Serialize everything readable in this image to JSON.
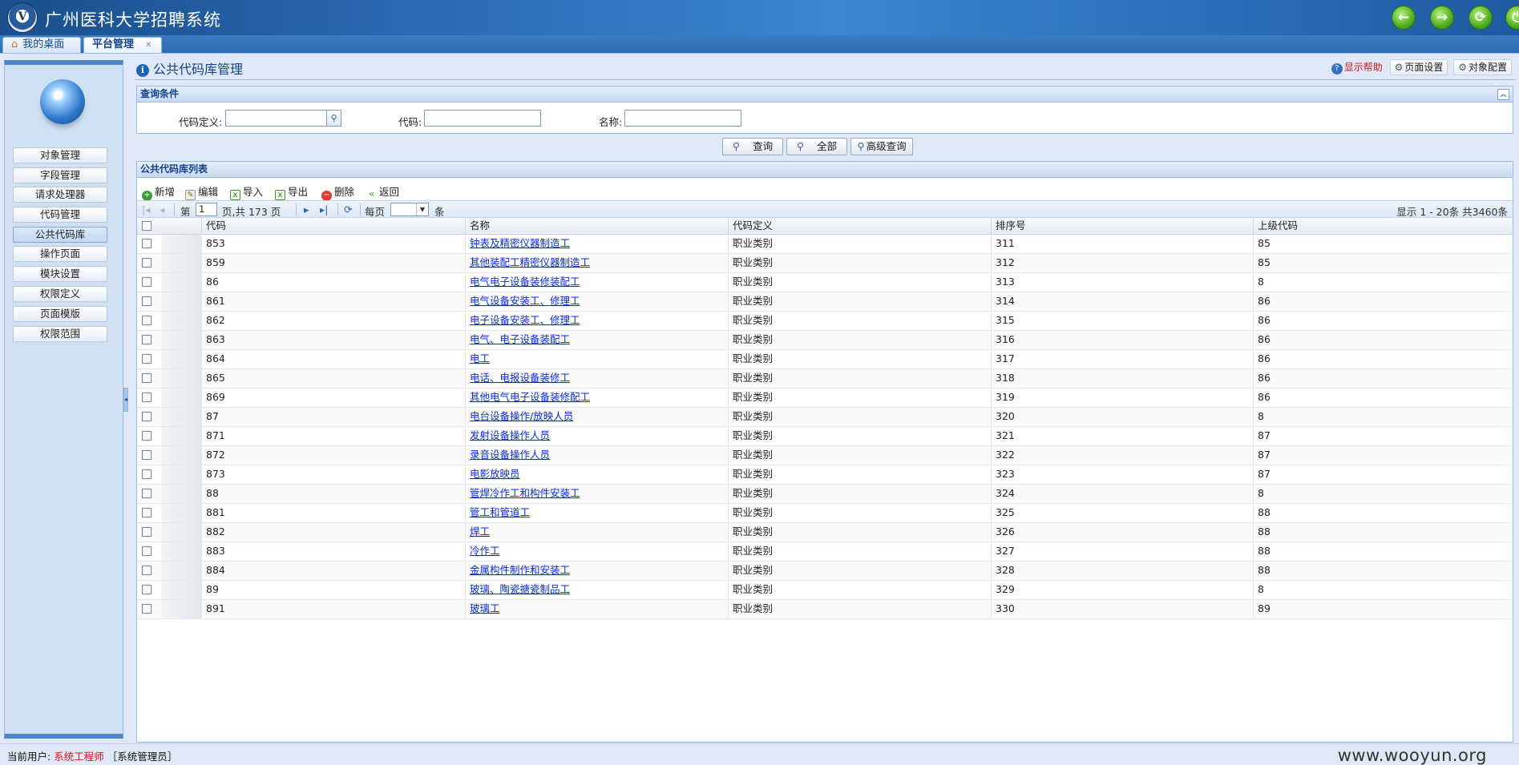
{
  "app": {
    "title": "广州医科大学招聘系统"
  },
  "colors": {
    "header": "#2b6db5",
    "link": "#0b2bd6",
    "help": "#d2161b",
    "panel_border": "#99bbe8"
  },
  "tabs": [
    {
      "label": "我的桌面",
      "icon": "home-icon"
    },
    {
      "label": "平台管理",
      "icon": "close-icon"
    }
  ],
  "sidebar": {
    "items": [
      {
        "label": "对象管理"
      },
      {
        "label": "字段管理"
      },
      {
        "label": "请求处理器"
      },
      {
        "label": "代码管理"
      },
      {
        "label": "公共代码库",
        "active": true
      },
      {
        "label": "操作页面"
      },
      {
        "label": "模块设置"
      },
      {
        "label": "权限定义"
      },
      {
        "label": "页面模版"
      },
      {
        "label": "权限范围"
      }
    ]
  },
  "page": {
    "title": "公共代码库管理",
    "help_label": "显示帮助",
    "page_settings_label": "页面设置",
    "object_config_label": "对象配置"
  },
  "query": {
    "title": "查询条件",
    "code_def_label": "代码定义:",
    "code_label": "代码:",
    "name_label": "名称:",
    "code_def_value": "",
    "code_value": "",
    "name_value": "",
    "search_button": "查询",
    "all_button": "全部",
    "advanced_button": "高级查询"
  },
  "list": {
    "title": "公共代码库列表",
    "toolbar": {
      "add": "新增",
      "edit": "编辑",
      "import": "导入",
      "export": "导出",
      "delete": "删除",
      "back": "返回"
    },
    "pager": {
      "page_prefix": "第",
      "page_value": "1",
      "page_suffix": "页,共 173 页",
      "per_page_label": "每页",
      "per_page_unit": "条",
      "summary": "显示 1 - 20条 共3460条"
    },
    "columns": [
      "代码",
      "名称",
      "代码定义",
      "排序号",
      "上级代码"
    ],
    "rows": [
      {
        "code": "853",
        "name": "钟表及精密仪器制造工",
        "def": "职业类别",
        "sort": "311",
        "parent": "85"
      },
      {
        "code": "859",
        "name": "其他装配工精密仪器制造工",
        "def": "职业类别",
        "sort": "312",
        "parent": "85"
      },
      {
        "code": "86",
        "name": "电气电子设备装修装配工",
        "def": "职业类别",
        "sort": "313",
        "parent": "8"
      },
      {
        "code": "861",
        "name": "电气设备安装工、修理工",
        "def": "职业类别",
        "sort": "314",
        "parent": "86"
      },
      {
        "code": "862",
        "name": "电子设备安装工、修理工",
        "def": "职业类别",
        "sort": "315",
        "parent": "86"
      },
      {
        "code": "863",
        "name": "电气、电子设备装配工",
        "def": "职业类别",
        "sort": "316",
        "parent": "86"
      },
      {
        "code": "864",
        "name": "电工",
        "def": "职业类别",
        "sort": "317",
        "parent": "86"
      },
      {
        "code": "865",
        "name": "电话、电报设备装修工",
        "def": "职业类别",
        "sort": "318",
        "parent": "86"
      },
      {
        "code": "869",
        "name": "其他电气电子设备装修配工",
        "def": "职业类别",
        "sort": "319",
        "parent": "86"
      },
      {
        "code": "87",
        "name": "电台设备操作/放映人员",
        "def": "职业类别",
        "sort": "320",
        "parent": "8"
      },
      {
        "code": "871",
        "name": "发射设备操作人员",
        "def": "职业类别",
        "sort": "321",
        "parent": "87"
      },
      {
        "code": "872",
        "name": "录音设备操作人员",
        "def": "职业类别",
        "sort": "322",
        "parent": "87"
      },
      {
        "code": "873",
        "name": "电影放映员",
        "def": "职业类别",
        "sort": "323",
        "parent": "87"
      },
      {
        "code": "88",
        "name": "管焊冷作工和构件安装工",
        "def": "职业类别",
        "sort": "324",
        "parent": "8"
      },
      {
        "code": "881",
        "name": "管工和管道工",
        "def": "职业类别",
        "sort": "325",
        "parent": "88"
      },
      {
        "code": "882",
        "name": "焊工",
        "def": "职业类别",
        "sort": "326",
        "parent": "88"
      },
      {
        "code": "883",
        "name": "冷作工",
        "def": "职业类别",
        "sort": "327",
        "parent": "88"
      },
      {
        "code": "884",
        "name": "金属构件制作和安装工",
        "def": "职业类别",
        "sort": "328",
        "parent": "88"
      },
      {
        "code": "89",
        "name": "玻璃、陶瓷搪瓷制品工",
        "def": "职业类别",
        "sort": "329",
        "parent": "8"
      },
      {
        "code": "891",
        "name": "玻璃工",
        "def": "职业类别",
        "sort": "330",
        "parent": "89"
      }
    ]
  },
  "footer": {
    "user_prefix": "当前用户:",
    "user_name": "系统工程师",
    "role": "［系统管理员］",
    "watermark": "www.wooyun.org"
  }
}
